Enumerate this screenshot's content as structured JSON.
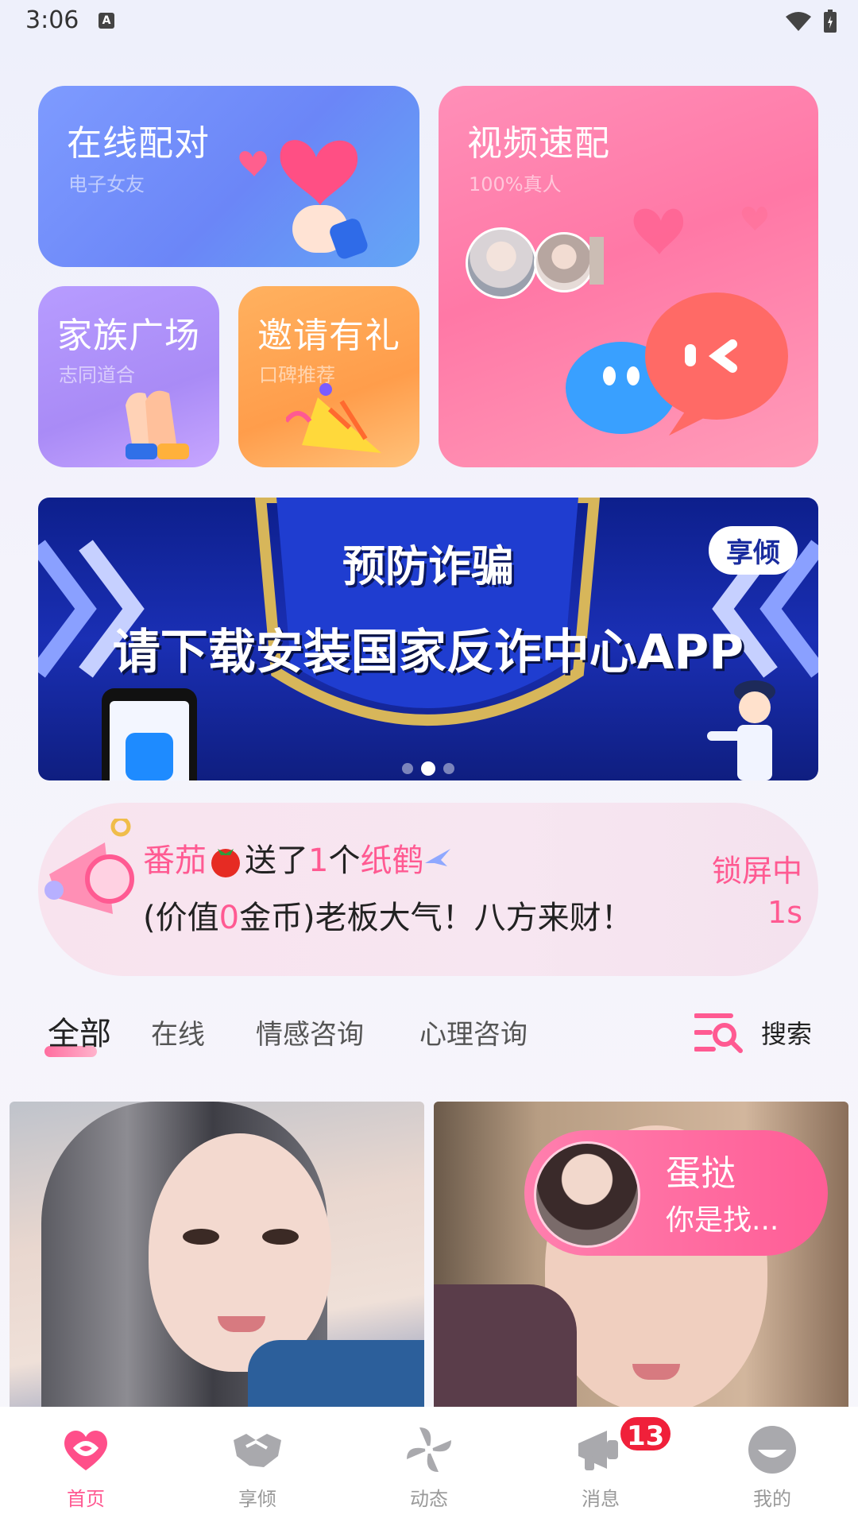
{
  "status_bar": {
    "time": "3:06",
    "a_icon": "A"
  },
  "tiles": {
    "online": {
      "title": "在线配对",
      "subtitle": "电子女友"
    },
    "video": {
      "title": "视频速配",
      "subtitle": "100%真人"
    },
    "family": {
      "title": "家族广场",
      "subtitle": "志同道合"
    },
    "invite": {
      "title": "邀请有礼",
      "subtitle": "口碑推荐"
    }
  },
  "banner": {
    "title": "预防诈骗",
    "subtitle": "请下载安装国家反诈中心APP",
    "tag": "享倾",
    "dot_count": 3,
    "active_dot": 1
  },
  "notice": {
    "sender": "番茄",
    "sent": "送了",
    "count": "1",
    "unit": "个",
    "gift": "纸鹤",
    "value_prefix": "(价值",
    "value": "0",
    "value_suffix": "金币)老板大气！八方来财！",
    "status": "锁屏中",
    "timer": "1s"
  },
  "tabs": [
    "全部",
    "在线",
    "情感咨询",
    "心理咨询"
  ],
  "search_label": "搜索",
  "popup_user": {
    "name": "蛋挞",
    "message": "你是找..."
  },
  "bottom_nav": [
    {
      "label": "首页",
      "icon": "heart-home-icon",
      "active": true
    },
    {
      "label": "享倾",
      "icon": "handshake-icon",
      "active": false
    },
    {
      "label": "动态",
      "icon": "pinwheel-icon",
      "active": false
    },
    {
      "label": "消息",
      "icon": "megaphone-icon",
      "active": false
    },
    {
      "label": "我的",
      "icon": "profile-icon",
      "active": false
    }
  ],
  "message_badge": "13",
  "colors": {
    "accent": "#ff5a92",
    "badge": "#f0203a"
  }
}
